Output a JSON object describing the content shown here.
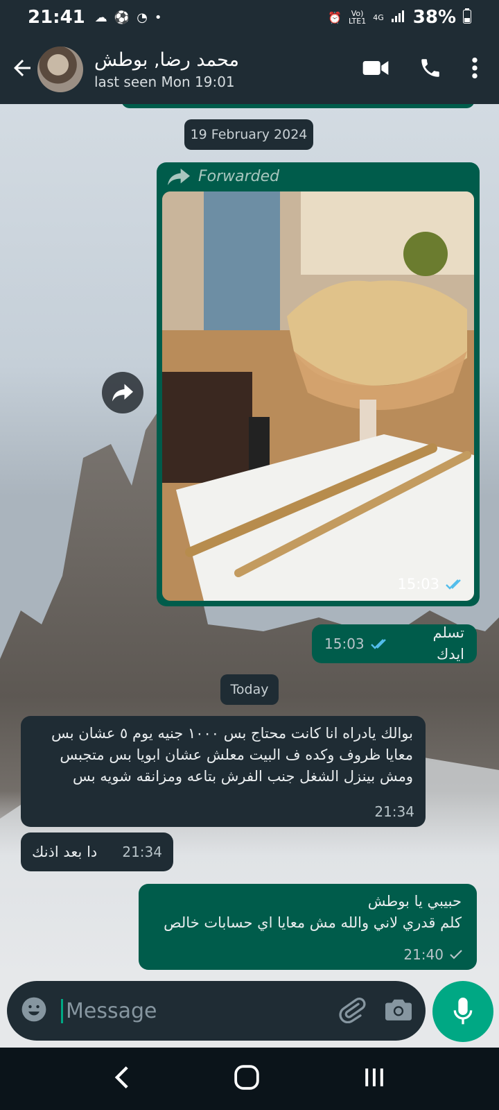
{
  "status_bar": {
    "time": "21:41",
    "network_top": "Vo)",
    "network_bottom": "LTE1",
    "gen": "4G",
    "battery": "38%"
  },
  "header": {
    "contact_name": "محمد رضا, بوطش",
    "last_seen": "last seen Mon 19:01"
  },
  "chat": {
    "date_1": "19 February 2024",
    "forwarded_label": "Forwarded",
    "photo_time": "15:03",
    "msg_out_1": {
      "text": "تسلم ايدك",
      "time": "15:03"
    },
    "date_2": "Today",
    "msg_in_1": {
      "lines": [
        "بوالك يادراه انا كانت محتاج بس ١٠٠٠ جنيه يوم ٥ عشان بس",
        "معايا ظروف وكده ف البيت معلش عشان ابويا بس متجبس",
        "ومش بينزل الشغل جنب الفرش بتاعه ومزانقه شويه بس"
      ],
      "time": "21:34"
    },
    "msg_in_2": {
      "text": "دا بعد اذنك",
      "time": "21:34"
    },
    "msg_out_2": {
      "lines": [
        "حبيبي يا بوطش",
        "كلم قدري لاني والله مش معايا اي حسابات خالص"
      ],
      "time": "21:40"
    }
  },
  "input": {
    "placeholder": "Message"
  },
  "colors": {
    "outgoing_bubble": "#005c4b",
    "incoming_bubble": "#1f2c34",
    "accent": "#00a884",
    "read_ticks": "#53bdeb"
  }
}
